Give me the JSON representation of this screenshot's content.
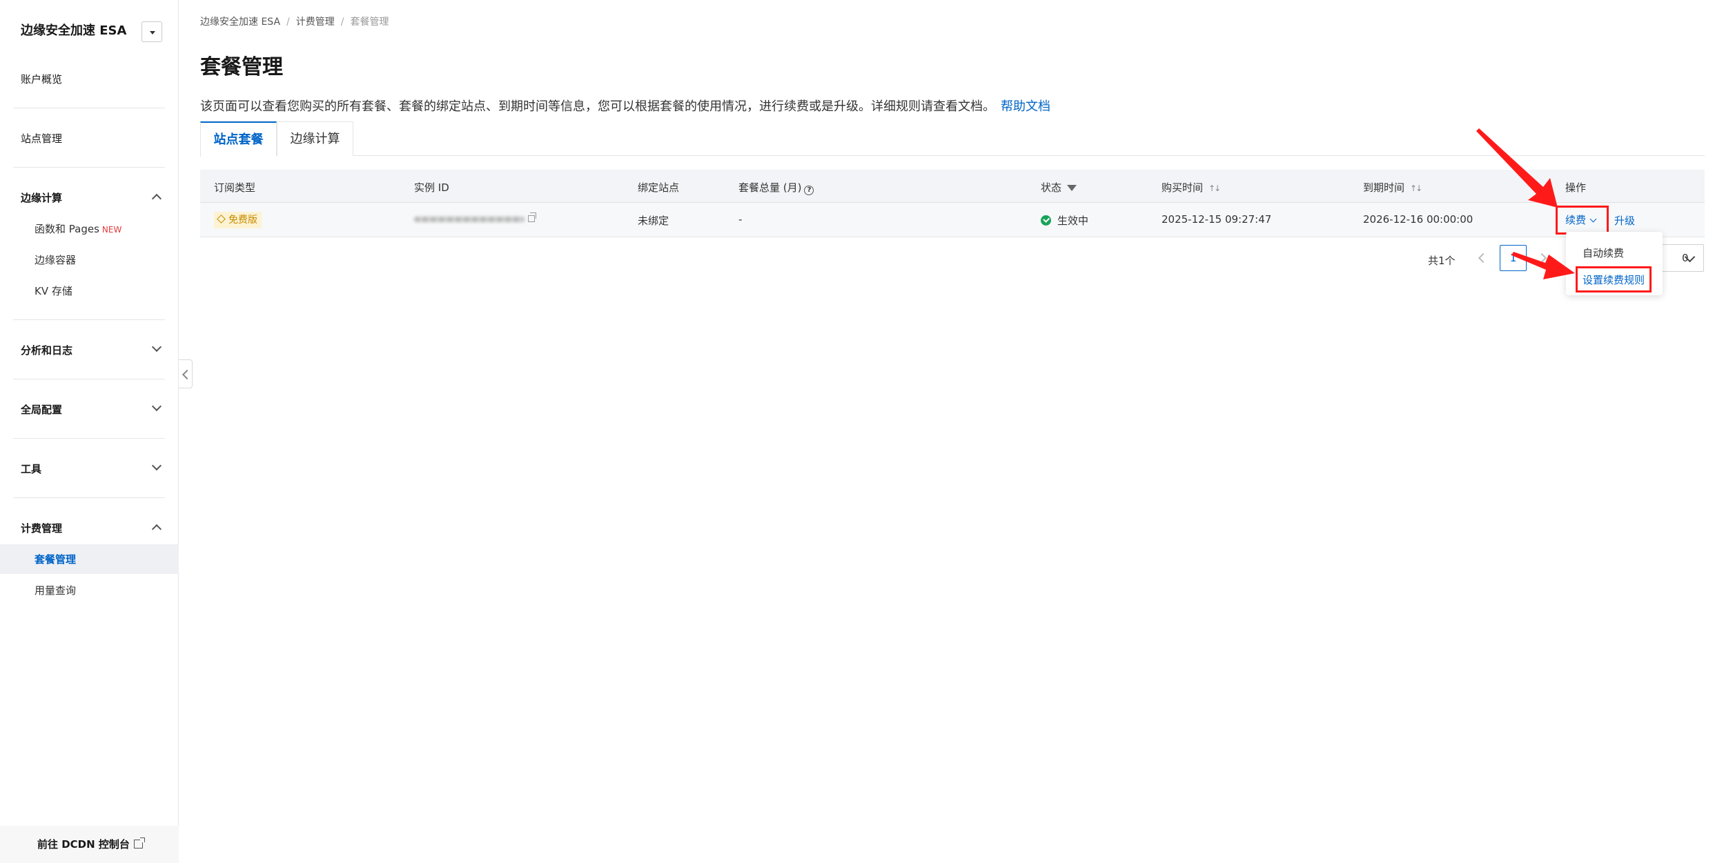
{
  "sidebar": {
    "product_title": "边缘安全加速 ESA",
    "items": {
      "overview": "账户概览",
      "site_mgmt": "站点管理",
      "edge_compute": "边缘计算",
      "functions_pages": "函数和 Pages",
      "new_badge": "NEW",
      "edge_container": "边缘容器",
      "kv_storage": "KV 存储",
      "analytics_logs": "分析和日志",
      "global_config": "全局配置",
      "tools": "工具",
      "billing": "计费管理",
      "plan_mgmt": "套餐管理",
      "usage_query": "用量查询"
    },
    "footer_link": "前往 DCDN 控制台"
  },
  "breadcrumb": [
    "边缘安全加速 ESA",
    "计费管理",
    "套餐管理"
  ],
  "page": {
    "title": "套餐管理",
    "description": "该页面可以查看您购买的所有套餐、套餐的绑定站点、到期时间等信息，您可以根据套餐的使用情况，进行续费或是升级。详细规则请查看文档。",
    "help_link": "帮助文档"
  },
  "tabs": [
    "站点套餐",
    "边缘计算"
  ],
  "table": {
    "headers": {
      "sub_type": "订阅类型",
      "instance_id": "实例 ID",
      "bound_site": "绑定站点",
      "plan_total": "套餐总量 (月)",
      "status": "状态",
      "purchase_time": "购买时间",
      "expire_time": "到期时间",
      "actions": "操作"
    },
    "rows": [
      {
        "sub_type": "免费版",
        "bound_site": "未绑定",
        "plan_total": "-",
        "status": "生效中",
        "purchase_time": "2025-12-15 09:27:47",
        "expire_time": "2026-12-16 00:00:00",
        "renew": "续费",
        "upgrade": "升级"
      }
    ]
  },
  "pagination": {
    "total": "共1个",
    "current": "1",
    "page_size": "0"
  },
  "renew_dropdown": {
    "items": [
      "自动续费",
      "设置续费规则"
    ]
  },
  "colors": {
    "primary": "#0064c8",
    "highlight_red": "#ff1a1a",
    "status_green": "#1aa35a"
  }
}
